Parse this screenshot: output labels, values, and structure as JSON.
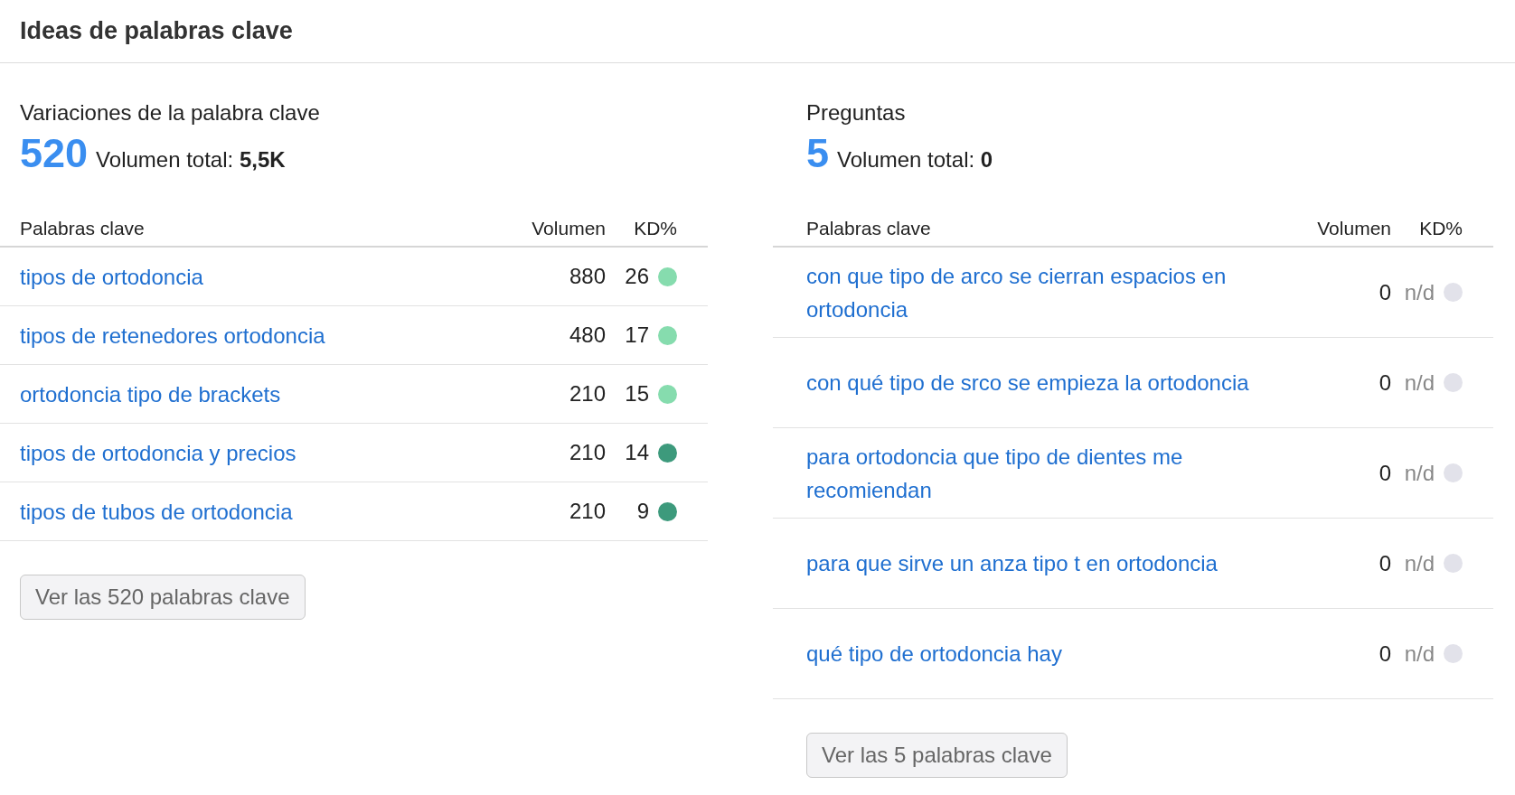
{
  "title": "Ideas de palabras clave",
  "sections": [
    {
      "heading": "Variaciones de la palabra clave",
      "count": "520",
      "total_label": "Volumen total:",
      "total_value": "5,5K",
      "columns": [
        "Palabras clave",
        "Volumen",
        "KD%"
      ],
      "button": "Ver las 520 palabras clave",
      "rows": [
        {
          "keyword": "tipos de ortodoncia",
          "volume": "880",
          "kd": "26",
          "color": "#86dcae"
        },
        {
          "keyword": "tipos de retenedores ortodoncia",
          "volume": "480",
          "kd": "17",
          "color": "#86dcae"
        },
        {
          "keyword": "ortodoncia tipo de brackets",
          "volume": "210",
          "kd": "15",
          "color": "#86dcae"
        },
        {
          "keyword": "tipos de ortodoncia y precios",
          "volume": "210",
          "kd": "14",
          "color": "#3d9a7c"
        },
        {
          "keyword": "tipos de tubos de ortodoncia",
          "volume": "210",
          "kd": "9",
          "color": "#3d9a7c"
        }
      ]
    },
    {
      "heading": "Preguntas",
      "count": "5",
      "total_label": "Volumen total:",
      "total_value": "0",
      "columns": [
        "Palabras clave",
        "Volumen",
        "KD%"
      ],
      "button": "Ver las 5 palabras clave",
      "rows": [
        {
          "keyword": "con que tipo de arco se cierran espacios en ortodoncia",
          "volume": "0",
          "kd": "n/d",
          "color": "#e2e2ea"
        },
        {
          "keyword": "con qué tipo de srco se empieza la ortodoncia",
          "volume": "0",
          "kd": "n/d",
          "color": "#e2e2ea"
        },
        {
          "keyword": "para ortodoncia que tipo de dientes me recomiendan",
          "volume": "0",
          "kd": "n/d",
          "color": "#e2e2ea"
        },
        {
          "keyword": "para que sirve un anza tipo t en ortodoncia",
          "volume": "0",
          "kd": "n/d",
          "color": "#e2e2ea"
        },
        {
          "keyword": "qué tipo de ortodoncia hay",
          "volume": "0",
          "kd": "n/d",
          "color": "#e2e2ea"
        }
      ]
    }
  ]
}
